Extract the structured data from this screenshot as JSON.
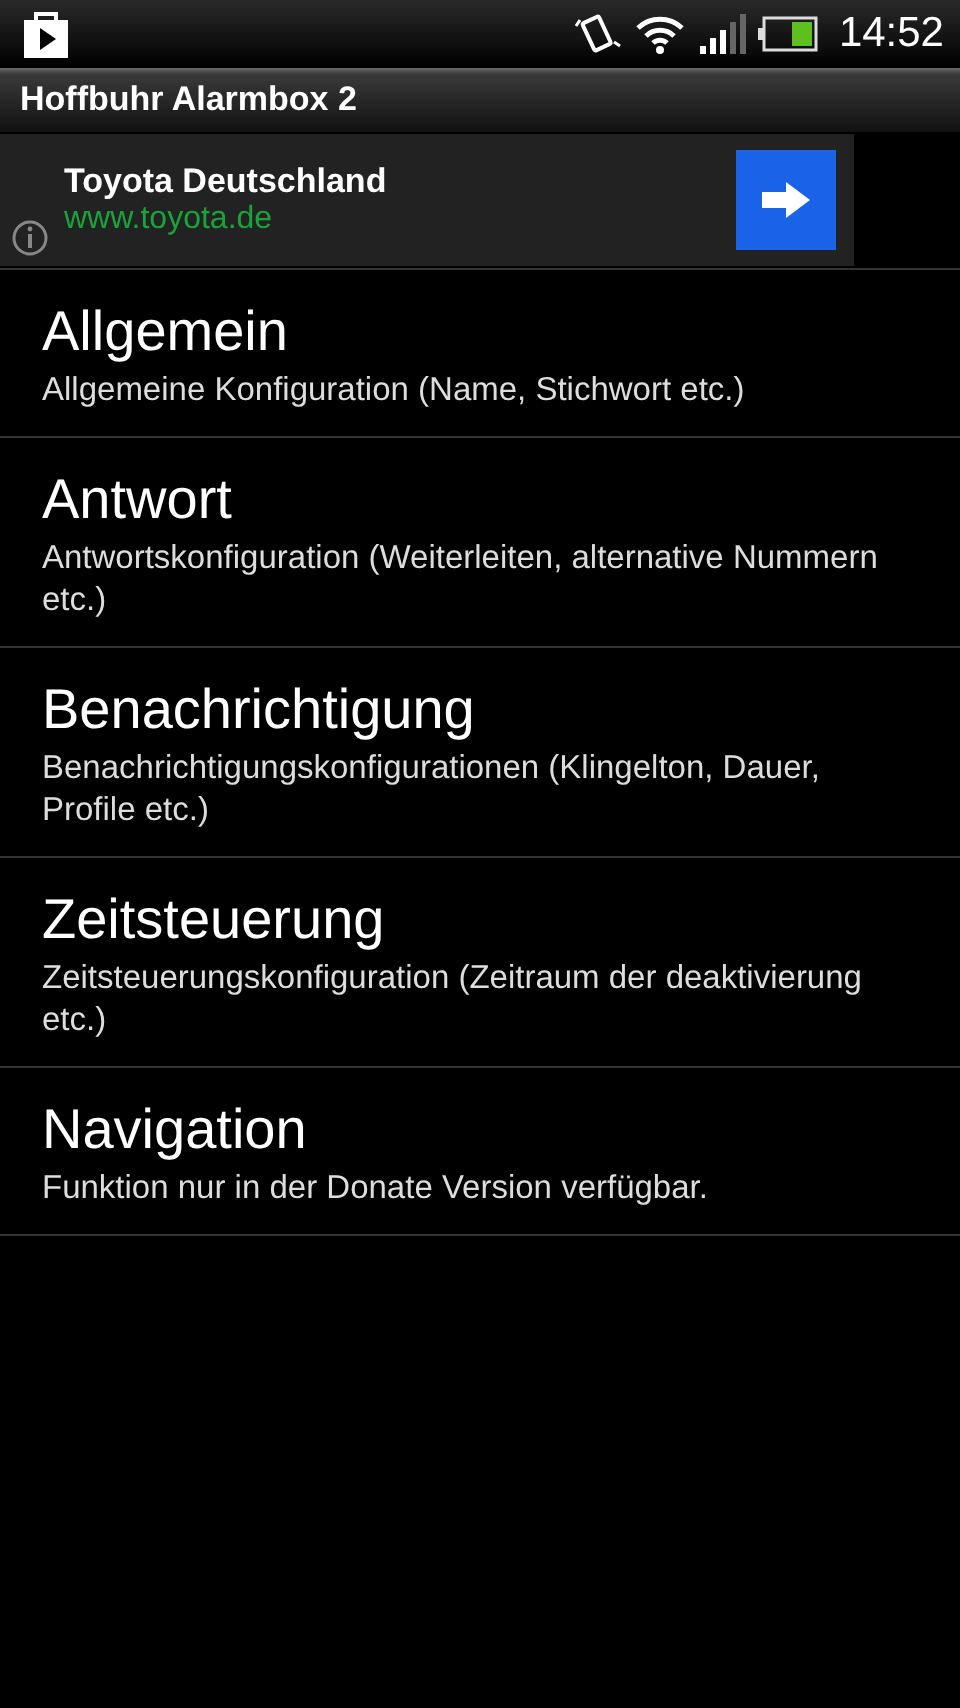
{
  "status_bar": {
    "time": "14:52"
  },
  "app_bar": {
    "title": "Hoffbuhr Alarmbox 2"
  },
  "ad": {
    "title": "Toyota Deutschland",
    "url": "www.toyota.de"
  },
  "settings": [
    {
      "title": "Allgemein",
      "summary": "Allgemeine Konfiguration (Name, Stichwort etc.)"
    },
    {
      "title": "Antwort",
      "summary": "Antwortskonfiguration (Weiterleiten, alternative Nummern etc.)"
    },
    {
      "title": "Benachrichtigung",
      "summary": "Benachrichtigungskonfigurationen (Klingelton, Dauer, Profile etc.)"
    },
    {
      "title": "Zeitsteuerung",
      "summary": "Zeitsteuerungskonfiguration (Zeitraum der deaktivierung etc.)"
    },
    {
      "title": "Navigation",
      "summary": "Funktion nur in der Donate Version verfügbar."
    }
  ]
}
